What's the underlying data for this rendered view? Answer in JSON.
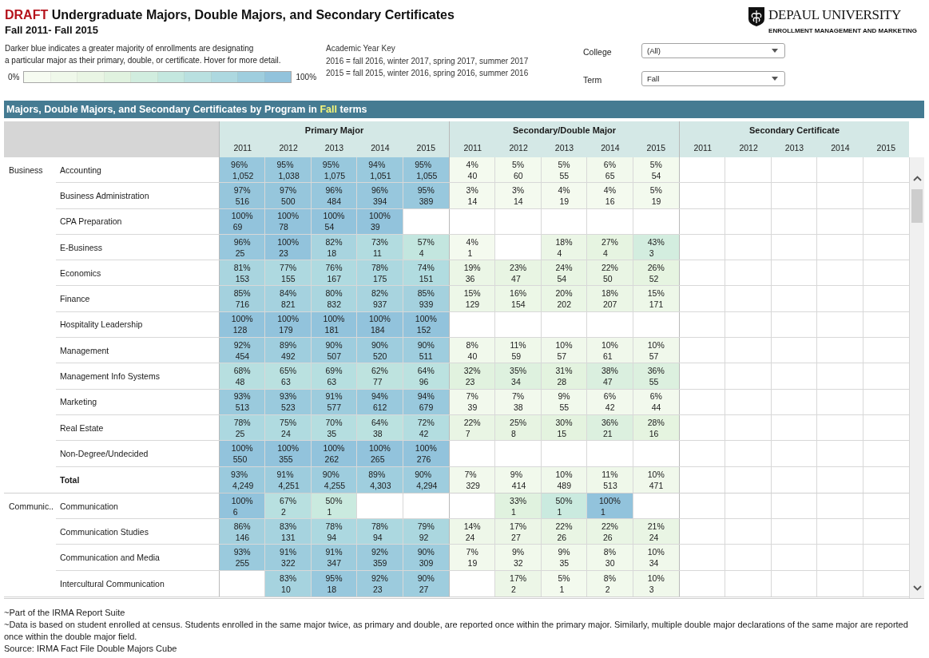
{
  "header": {
    "draft_label": "DRAFT",
    "title": "Undergraduate Majors, Double Majors, and Secondary Certificates",
    "subtitle": "Fall 2011- Fall 2015"
  },
  "logo": {
    "name": "DEPAUL UNIVERSITY",
    "tagline": "ENROLLMENT MANAGEMENT AND MARKETING"
  },
  "description": "Darker blue indicates a greater majority of enrollments are designating\na particular major as their primary, double, or certificate. Hover for more detail.",
  "legend": {
    "min_label": "0%",
    "max_label": "100%"
  },
  "year_key": {
    "title": "Academic Year Key",
    "lines": [
      "2016 = fall 2016, winter 2017, spring 2017, summer 2017",
      "2015 = fall 2015, winter 2016, spring 2016, summer 2016"
    ]
  },
  "filters": [
    {
      "label": "College",
      "value": "(All)"
    },
    {
      "label": "Term",
      "value": "Fall"
    }
  ],
  "section": {
    "title": "Majors, Double Majors, and Secondary Certificates by Program in",
    "term": "Fall",
    "suffix": "terms"
  },
  "table": {
    "groups": [
      {
        "title": "Primary Major",
        "years": [
          "2011",
          "2012",
          "2013",
          "2014",
          "2015"
        ]
      },
      {
        "title": "Secondary/Double Major",
        "years": [
          "2011",
          "2012",
          "2013",
          "2014",
          "2015"
        ]
      },
      {
        "title": "Secondary Certificate",
        "years": [
          "2011",
          "2012",
          "2013",
          "2014",
          "2015"
        ]
      }
    ],
    "colleges": [
      {
        "name": "Business",
        "rows": [
          {
            "kind": "program",
            "label": "Accounting",
            "cells": [
              [
                {
                  "pct": "96%",
                  "count": "1,052"
                },
                {
                  "pct": "95%",
                  "count": "1,038"
                },
                {
                  "pct": "95%",
                  "count": "1,075"
                },
                {
                  "pct": "94%",
                  "count": "1,051"
                },
                {
                  "pct": "95%",
                  "count": "1,055"
                }
              ],
              [
                {
                  "pct": "4%",
                  "count": "40"
                },
                {
                  "pct": "5%",
                  "count": "60"
                },
                {
                  "pct": "5%",
                  "count": "55"
                },
                {
                  "pct": "6%",
                  "count": "65"
                },
                {
                  "pct": "5%",
                  "count": "54"
                }
              ]
            ]
          },
          {
            "kind": "program",
            "label": "Business Administration",
            "cells": [
              [
                {
                  "pct": "97%",
                  "count": "516"
                },
                {
                  "pct": "97%",
                  "count": "500"
                },
                {
                  "pct": "96%",
                  "count": "484"
                },
                {
                  "pct": "96%",
                  "count": "394"
                },
                {
                  "pct": "95%",
                  "count": "389"
                }
              ],
              [
                {
                  "pct": "3%",
                  "count": "14"
                },
                {
                  "pct": "3%",
                  "count": "14"
                },
                {
                  "pct": "4%",
                  "count": "19"
                },
                {
                  "pct": "4%",
                  "count": "16"
                },
                {
                  "pct": "5%",
                  "count": "19"
                }
              ]
            ]
          },
          {
            "kind": "program",
            "label": "CPA Preparation",
            "cells": [
              [
                {
                  "pct": "100%",
                  "count": "69"
                },
                {
                  "pct": "100%",
                  "count": "78"
                },
                {
                  "pct": "100%",
                  "count": "54"
                },
                {
                  "pct": "100%",
                  "count": "39"
                },
                null
              ]
            ]
          },
          {
            "kind": "program",
            "label": "E-Business",
            "cells": [
              [
                {
                  "pct": "96%",
                  "count": "25"
                },
                {
                  "pct": "100%",
                  "count": "23"
                },
                {
                  "pct": "82%",
                  "count": "18"
                },
                {
                  "pct": "73%",
                  "count": "11"
                },
                {
                  "pct": "57%",
                  "count": "4"
                }
              ],
              [
                {
                  "pct": "4%",
                  "count": "1"
                },
                null,
                {
                  "pct": "18%",
                  "count": "4"
                },
                {
                  "pct": "27%",
                  "count": "4"
                },
                {
                  "pct": "43%",
                  "count": "3"
                }
              ]
            ]
          },
          {
            "kind": "program",
            "label": "Economics",
            "cells": [
              [
                {
                  "pct": "81%",
                  "count": "153"
                },
                {
                  "pct": "77%",
                  "count": "155"
                },
                {
                  "pct": "76%",
                  "count": "167"
                },
                {
                  "pct": "78%",
                  "count": "175"
                },
                {
                  "pct": "74%",
                  "count": "151"
                }
              ],
              [
                {
                  "pct": "19%",
                  "count": "36"
                },
                {
                  "pct": "23%",
                  "count": "47"
                },
                {
                  "pct": "24%",
                  "count": "54"
                },
                {
                  "pct": "22%",
                  "count": "50"
                },
                {
                  "pct": "26%",
                  "count": "52"
                }
              ]
            ]
          },
          {
            "kind": "program",
            "label": "Finance",
            "cells": [
              [
                {
                  "pct": "85%",
                  "count": "716"
                },
                {
                  "pct": "84%",
                  "count": "821"
                },
                {
                  "pct": "80%",
                  "count": "832"
                },
                {
                  "pct": "82%",
                  "count": "937"
                },
                {
                  "pct": "85%",
                  "count": "939"
                }
              ],
              [
                {
                  "pct": "15%",
                  "count": "129"
                },
                {
                  "pct": "16%",
                  "count": "154"
                },
                {
                  "pct": "20%",
                  "count": "202"
                },
                {
                  "pct": "18%",
                  "count": "207"
                },
                {
                  "pct": "15%",
                  "count": "171"
                }
              ]
            ]
          },
          {
            "kind": "program",
            "label": "Hospitality Leadership",
            "cells": [
              [
                {
                  "pct": "100%",
                  "count": "128"
                },
                {
                  "pct": "100%",
                  "count": "179"
                },
                {
                  "pct": "100%",
                  "count": "181"
                },
                {
                  "pct": "100%",
                  "count": "184"
                },
                {
                  "pct": "100%",
                  "count": "152"
                }
              ]
            ]
          },
          {
            "kind": "program",
            "label": "Management",
            "cells": [
              [
                {
                  "pct": "92%",
                  "count": "454"
                },
                {
                  "pct": "89%",
                  "count": "492"
                },
                {
                  "pct": "90%",
                  "count": "507"
                },
                {
                  "pct": "90%",
                  "count": "520"
                },
                {
                  "pct": "90%",
                  "count": "511"
                }
              ],
              [
                {
                  "pct": "8%",
                  "count": "40"
                },
                {
                  "pct": "11%",
                  "count": "59"
                },
                {
                  "pct": "10%",
                  "count": "57"
                },
                {
                  "pct": "10%",
                  "count": "61"
                },
                {
                  "pct": "10%",
                  "count": "57"
                }
              ]
            ]
          },
          {
            "kind": "program",
            "label": "Management Info Systems",
            "cells": [
              [
                {
                  "pct": "68%",
                  "count": "48"
                },
                {
                  "pct": "65%",
                  "count": "63"
                },
                {
                  "pct": "69%",
                  "count": "63"
                },
                {
                  "pct": "62%",
                  "count": "77"
                },
                {
                  "pct": "64%",
                  "count": "96"
                }
              ],
              [
                {
                  "pct": "32%",
                  "count": "23"
                },
                {
                  "pct": "35%",
                  "count": "34"
                },
                {
                  "pct": "31%",
                  "count": "28"
                },
                {
                  "pct": "38%",
                  "count": "47"
                },
                {
                  "pct": "36%",
                  "count": "55"
                }
              ]
            ]
          },
          {
            "kind": "program",
            "label": "Marketing",
            "cells": [
              [
                {
                  "pct": "93%",
                  "count": "513"
                },
                {
                  "pct": "93%",
                  "count": "523"
                },
                {
                  "pct": "91%",
                  "count": "577"
                },
                {
                  "pct": "94%",
                  "count": "612"
                },
                {
                  "pct": "94%",
                  "count": "679"
                }
              ],
              [
                {
                  "pct": "7%",
                  "count": "39"
                },
                {
                  "pct": "7%",
                  "count": "38"
                },
                {
                  "pct": "9%",
                  "count": "55"
                },
                {
                  "pct": "6%",
                  "count": "42"
                },
                {
                  "pct": "6%",
                  "count": "44"
                }
              ]
            ]
          },
          {
            "kind": "program",
            "label": "Real Estate",
            "cells": [
              [
                {
                  "pct": "78%",
                  "count": "25"
                },
                {
                  "pct": "75%",
                  "count": "24"
                },
                {
                  "pct": "70%",
                  "count": "35"
                },
                {
                  "pct": "64%",
                  "count": "38"
                },
                {
                  "pct": "72%",
                  "count": "42"
                }
              ],
              [
                {
                  "pct": "22%",
                  "count": "7"
                },
                {
                  "pct": "25%",
                  "count": "8"
                },
                {
                  "pct": "30%",
                  "count": "15"
                },
                {
                  "pct": "36%",
                  "count": "21"
                },
                {
                  "pct": "28%",
                  "count": "16"
                }
              ]
            ]
          },
          {
            "kind": "program",
            "label": "Non-Degree/Undecided",
            "cells": [
              [
                {
                  "pct": "100%",
                  "count": "550"
                },
                {
                  "pct": "100%",
                  "count": "355"
                },
                {
                  "pct": "100%",
                  "count": "262"
                },
                {
                  "pct": "100%",
                  "count": "265"
                },
                {
                  "pct": "100%",
                  "count": "276"
                }
              ]
            ]
          },
          {
            "kind": "total",
            "label": "Total",
            "cells": [
              [
                {
                  "pct": "93%",
                  "count": "4,249"
                },
                {
                  "pct": "91%",
                  "count": "4,251"
                },
                {
                  "pct": "90%",
                  "count": "4,255"
                },
                {
                  "pct": "89%",
                  "count": "4,303"
                },
                {
                  "pct": "90%",
                  "count": "4,294"
                }
              ],
              [
                {
                  "pct": "7%",
                  "count": "329"
                },
                {
                  "pct": "9%",
                  "count": "414"
                },
                {
                  "pct": "10%",
                  "count": "489"
                },
                {
                  "pct": "11%",
                  "count": "513"
                },
                {
                  "pct": "10%",
                  "count": "471"
                }
              ]
            ]
          }
        ]
      },
      {
        "name": "Communic..",
        "rows": [
          {
            "kind": "program",
            "label": "Communication",
            "cells": [
              [
                {
                  "pct": "100%",
                  "count": "6"
                },
                {
                  "pct": "67%",
                  "count": "2"
                },
                {
                  "pct": "50%",
                  "count": "1"
                },
                null,
                null
              ],
              [
                null,
                {
                  "pct": "33%",
                  "count": "1"
                },
                {
                  "pct": "50%",
                  "count": "1"
                },
                {
                  "pct": "100%",
                  "count": "1"
                },
                null
              ]
            ]
          },
          {
            "kind": "program",
            "label": "Communication Studies",
            "cells": [
              [
                {
                  "pct": "86%",
                  "count": "146"
                },
                {
                  "pct": "83%",
                  "count": "131"
                },
                {
                  "pct": "78%",
                  "count": "94"
                },
                {
                  "pct": "78%",
                  "count": "94"
                },
                {
                  "pct": "79%",
                  "count": "92"
                }
              ],
              [
                {
                  "pct": "14%",
                  "count": "24"
                },
                {
                  "pct": "17%",
                  "count": "27"
                },
                {
                  "pct": "22%",
                  "count": "26"
                },
                {
                  "pct": "22%",
                  "count": "26"
                },
                {
                  "pct": "21%",
                  "count": "24"
                }
              ]
            ]
          },
          {
            "kind": "program",
            "label": "Communication and Media",
            "cells": [
              [
                {
                  "pct": "93%",
                  "count": "255"
                },
                {
                  "pct": "91%",
                  "count": "322"
                },
                {
                  "pct": "91%",
                  "count": "347"
                },
                {
                  "pct": "92%",
                  "count": "359"
                },
                {
                  "pct": "90%",
                  "count": "309"
                }
              ],
              [
                {
                  "pct": "7%",
                  "count": "19"
                },
                {
                  "pct": "9%",
                  "count": "32"
                },
                {
                  "pct": "9%",
                  "count": "35"
                },
                {
                  "pct": "8%",
                  "count": "30"
                },
                {
                  "pct": "10%",
                  "count": "34"
                }
              ]
            ]
          },
          {
            "kind": "program",
            "label": "Intercultural Communication",
            "cells": [
              [
                null,
                {
                  "pct": "83%",
                  "count": "10"
                },
                {
                  "pct": "95%",
                  "count": "18"
                },
                {
                  "pct": "92%",
                  "count": "23"
                },
                {
                  "pct": "90%",
                  "count": "27"
                }
              ],
              [
                null,
                {
                  "pct": "17%",
                  "count": "2"
                },
                {
                  "pct": "5%",
                  "count": "1"
                },
                {
                  "pct": "8%",
                  "count": "2"
                },
                {
                  "pct": "10%",
                  "count": "3"
                }
              ]
            ]
          }
        ]
      }
    ]
  },
  "footer": [
    "~Part of the IRMA Report Suite",
    "~Data is based on student enrolled at census. Students enrolled in the same major twice, as primary and double, are reported once within the primary major. Similarly, multiple double major declarations of the same major are reported once within the double major field.",
    "Source: IRMA Fact File Double Majors Cube"
  ]
}
